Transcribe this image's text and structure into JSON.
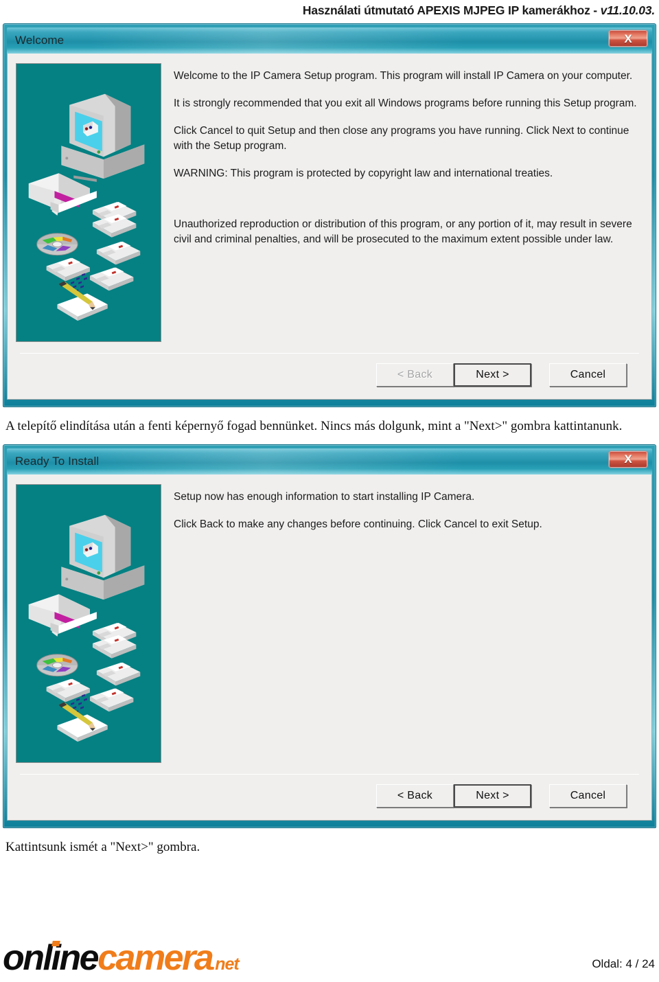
{
  "header": {
    "title_main": "Használati útmutató APEXIS MJPEG IP kamerákhoz - ",
    "title_version": "v11.10.03."
  },
  "dialogs": [
    {
      "name": "welcome",
      "title": "Welcome",
      "close_label": "X",
      "close_icon": "close-icon",
      "paragraphs": [
        "Welcome to the IP Camera Setup program. This program will install IP Camera on your computer.",
        "It is strongly recommended that you exit all Windows programs before running this Setup program.",
        "Click Cancel to quit Setup and then close any programs you have running. Click Next to continue with the Setup program.",
        "WARNING: This program is protected by copyright law and international treaties.",
        "Unauthorized reproduction or distribution of this program, or any portion of it, may result in severe civil and criminal penalties, and will be prosecuted to the maximum extent possible under law."
      ],
      "buttons": {
        "back": "< Back",
        "back_enabled": false,
        "next": "Next >",
        "next_default": true,
        "cancel": "Cancel"
      }
    },
    {
      "name": "ready-to-install",
      "title": "Ready To Install",
      "close_label": "X",
      "close_icon": "close-icon",
      "paragraphs": [
        "Setup now has enough information to start installing IP Camera.",
        "Click Back to make any changes before continuing. Click Cancel to exit Setup."
      ],
      "buttons": {
        "back": "< Back",
        "back_enabled": true,
        "next": "Next >",
        "next_default": true,
        "cancel": "Cancel"
      }
    }
  ],
  "captions": {
    "after_first": "A telepítő elindítása után a fenti képernyő fogad bennünket. Nincs más dolgunk, mint a \"Next>\" gombra kattintanunk.",
    "after_second": "Kattintsunk ismét a \"Next>\" gombra."
  },
  "footer": {
    "logo_part1": "online",
    "logo_part2": "camera",
    "logo_part3": ".net",
    "page_label": "Oldal: 4 / 24"
  },
  "colors": {
    "titlebar_teal": "#1e8fa8",
    "illustration_bg": "#058183",
    "close_red": "#cf5341",
    "logo_orange": "#f07d1a",
    "dialog_face": "#f0efee"
  }
}
